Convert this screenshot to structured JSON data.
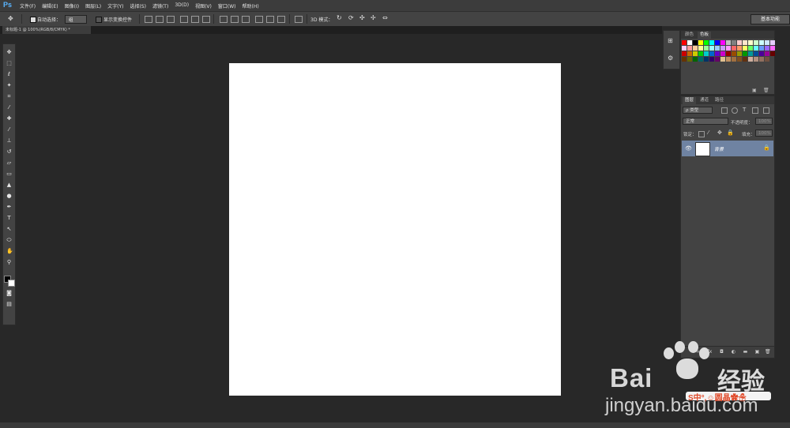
{
  "app": {
    "logo": "Ps"
  },
  "menu": [
    "文件(F)",
    "编辑(E)",
    "图像(I)",
    "图层(L)",
    "文字(Y)",
    "选择(S)",
    "滤镜(T)",
    "3D(D)",
    "视图(V)",
    "窗口(W)",
    "帮助(H)"
  ],
  "options": {
    "auto_select_label": "自动选择：",
    "auto_select_value": "组",
    "show_transform_label": "显示变换控件",
    "mode_3d_label": "3D 模式：",
    "workspace": "基本功能"
  },
  "document": {
    "tab_title": "未标题-1 @ 100%(RGB/8/CMYK) *"
  },
  "swatches_panel": {
    "tabs": [
      "颜色",
      "色板"
    ],
    "colors": [
      "#ff0000",
      "#ffffff",
      "#000000",
      "#ffff00",
      "#00ff00",
      "#00ffff",
      "#0000ff",
      "#ff00ff",
      "#c0c0c0",
      "#808080",
      "#ffcccc",
      "#ffe6cc",
      "#ffffcc",
      "#ccffcc",
      "#ccffff",
      "#cce6ff",
      "#e6ccff",
      "#ffccff",
      "#ff9999",
      "#ffcc99",
      "#ffff99",
      "#99ff99",
      "#99ffff",
      "#99ccff",
      "#cc99ff",
      "#ff99ff",
      "#ff6666",
      "#ff9966",
      "#ffff66",
      "#66ff66",
      "#66ffff",
      "#6699ff",
      "#9966ff",
      "#ff66ff",
      "#cc0000",
      "#cc6600",
      "#cccc00",
      "#00cc00",
      "#00cccc",
      "#0066cc",
      "#6600cc",
      "#cc00cc",
      "#990000",
      "#994c00",
      "#999900",
      "#009900",
      "#009999",
      "#004c99",
      "#4c0099",
      "#990099",
      "#660000",
      "#663300",
      "#666600",
      "#006600",
      "#006666",
      "#003366",
      "#330066",
      "#660066",
      "#e0c090",
      "#c09060",
      "#a07040",
      "#805020",
      "#603010",
      "#d0b0a0",
      "#b09080",
      "#907060",
      "#705040"
    ]
  },
  "layers_panel": {
    "tabs": [
      "图层",
      "通道",
      "路径"
    ],
    "filter_label": "ρ 类型",
    "blend_mode": "正常",
    "opacity_label": "不透明度：",
    "opacity_value": "100%",
    "lock_label": "锁定：",
    "fill_label": "填充：",
    "fill_value": "100%",
    "layers": [
      {
        "name": "背景",
        "visible": true,
        "locked": true
      }
    ]
  },
  "watermark": {
    "brand": "Bai",
    "brand_cn": "经验",
    "url": "jingyan.baidu.com",
    "strip_text": "S中°,☺圆晶✿☃"
  }
}
